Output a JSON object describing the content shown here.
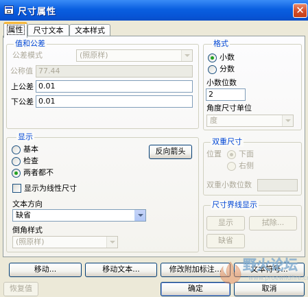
{
  "window": {
    "title": "尺寸属性",
    "close_glyph": "✕"
  },
  "tabs": [
    {
      "label": "属性",
      "active": true
    },
    {
      "label": "尺寸文本",
      "active": false
    },
    {
      "label": "文本样式",
      "active": false
    }
  ],
  "value_tolerance": {
    "legend": "值和公差",
    "tolerance_mode_label": "公差模式",
    "tolerance_mode_value": "(照原样)",
    "nominal_label": "公称值",
    "nominal_value": "77.44",
    "upper_label": "上公差",
    "upper_value": "0.01",
    "lower_label": "下公差",
    "lower_value": "0.01"
  },
  "format": {
    "legend": "格式",
    "decimal_label": "小数",
    "fraction_label": "分数",
    "selected": "decimal",
    "decimal_places_label": "小数位数",
    "decimal_places_value": "2",
    "angular_unit_label": "角度尺寸单位",
    "angular_unit_value": "度"
  },
  "display": {
    "legend": "显示",
    "basic_label": "基本",
    "inspect_label": "检查",
    "neither_label": "两者都不",
    "selected": "neither",
    "flip_arrows_label": "反向箭头",
    "linear_label": "显示为线性尺寸",
    "linear_checked": false,
    "text_direction_label": "文本方向",
    "text_direction_value": "缺省",
    "chamfer_label": "倒角样式",
    "chamfer_value": "(照原样)"
  },
  "dual": {
    "legend": "双重尺寸",
    "position_label": "位置",
    "below_label": "下面",
    "right_label": "右侧",
    "dual_decimal_label": "双重小数位数"
  },
  "witness": {
    "legend": "尺寸界线显示",
    "show_label": "显示",
    "erase_label": "拭除...",
    "default_label": "缺省"
  },
  "bottom_row": {
    "move_label": "移动...",
    "move_text_label": "移动文本...",
    "modify_attach_label": "修改附加标注...",
    "text_symbol_label": "文本符号..."
  },
  "footer": {
    "restore_label": "恢复值",
    "ok_label": "确定",
    "cancel_label": "取消"
  },
  "watermark": {
    "line1": "野火论坛",
    "line2": "www.proewildfire.cn"
  }
}
